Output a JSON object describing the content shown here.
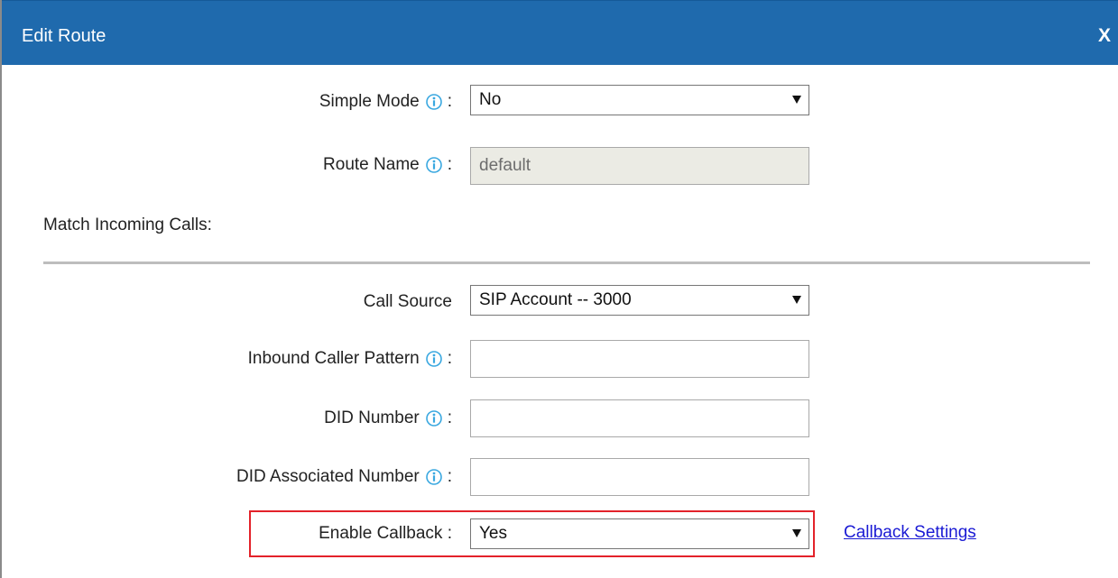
{
  "dialog": {
    "title": "Edit Route",
    "close_label": "X"
  },
  "fields": {
    "simple_mode": {
      "label": "Simple Mode",
      "value": "No"
    },
    "route_name": {
      "label": "Route Name",
      "value": "default"
    },
    "match_incoming_calls": {
      "label": "Match Incoming Calls:"
    },
    "call_source": {
      "label": "Call Source",
      "value": "SIP Account -- 3000"
    },
    "inbound_caller_pattern": {
      "label": "Inbound Caller Pattern",
      "value": ""
    },
    "did_number": {
      "label": "DID Number",
      "value": ""
    },
    "did_associated_number": {
      "label": "DID Associated Number",
      "value": ""
    },
    "enable_callback": {
      "label": "Enable Callback :",
      "value": "Yes"
    }
  },
  "colon": ":",
  "callback_settings_link": "Callback Settings",
  "colors": {
    "titlebar": "#1f6aad",
    "highlight": "#e3222a",
    "link": "#1a1ad4",
    "info_icon": "#3aa8e0"
  },
  "icons": {
    "info": "info-icon",
    "dropdown": "chevron-down-icon"
  }
}
